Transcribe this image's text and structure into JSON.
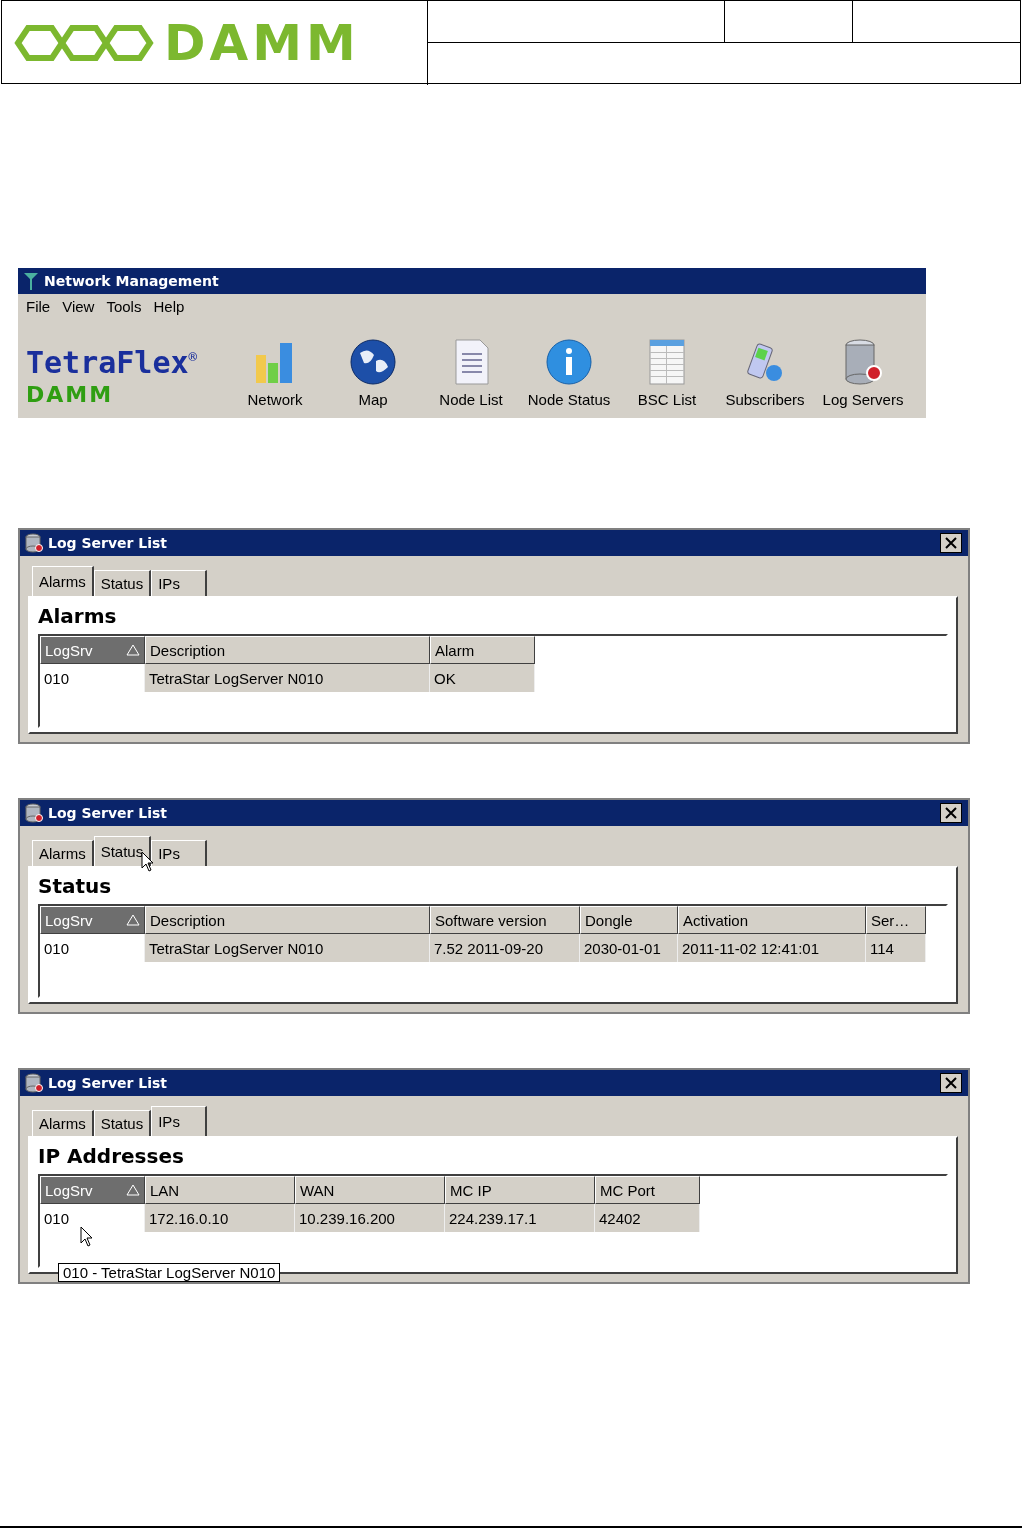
{
  "header": {
    "logo_text": "DAMM"
  },
  "network_management": {
    "title": "Network Management",
    "menu": [
      "File",
      "View",
      "Tools",
      "Help"
    ],
    "logo": {
      "name": "TetraFlex",
      "mark": "®",
      "brand": "DAMM"
    },
    "toolbar": [
      {
        "label": "Network",
        "kind": "chart"
      },
      {
        "label": "Map",
        "kind": "globe"
      },
      {
        "label": "Node List",
        "kind": "document"
      },
      {
        "label": "Node Status",
        "kind": "info"
      },
      {
        "label": "BSC List",
        "kind": "sheet"
      },
      {
        "label": "Subscribers",
        "kind": "phone"
      },
      {
        "label": "Log Servers",
        "kind": "database"
      }
    ]
  },
  "log_windows": [
    {
      "title": "Log Server List",
      "tabs": [
        {
          "label": "Alarms",
          "selected": true,
          "hovered": false
        },
        {
          "label": "Status",
          "selected": false,
          "hovered": false
        },
        {
          "label": "IPs",
          "selected": false,
          "hovered": false
        }
      ],
      "heading": "Alarms",
      "row_hovered": false,
      "columns": [
        {
          "label": "LogSrv",
          "sorted": true
        },
        {
          "label": "Description",
          "sorted": false
        },
        {
          "label": "Alarm",
          "sorted": false
        }
      ],
      "rows": [
        [
          "010",
          "TetraStar LogServer N010",
          "OK"
        ]
      ]
    },
    {
      "title": "Log Server List",
      "tabs": [
        {
          "label": "Alarms",
          "selected": false,
          "hovered": false
        },
        {
          "label": "Status",
          "selected": true,
          "hovered": true
        },
        {
          "label": "IPs",
          "selected": false,
          "hovered": false
        }
      ],
      "heading": "Status",
      "row_hovered": false,
      "columns": [
        {
          "label": "LogSrv",
          "sorted": true
        },
        {
          "label": "Description",
          "sorted": false
        },
        {
          "label": "Software version",
          "sorted": false
        },
        {
          "label": "Dongle",
          "sorted": false
        },
        {
          "label": "Activation",
          "sorted": false
        },
        {
          "label": "Ser…",
          "sorted": false
        }
      ],
      "rows": [
        [
          "010",
          "TetraStar LogServer N010",
          "7.52 2011-09-20",
          "2030-01-01",
          "2011-11-02 12:41:01",
          "114"
        ]
      ]
    },
    {
      "title": "Log Server List",
      "tabs": [
        {
          "label": "Alarms",
          "selected": false,
          "hovered": false
        },
        {
          "label": "Status",
          "selected": false,
          "hovered": false
        },
        {
          "label": "IPs",
          "selected": true,
          "hovered": false
        }
      ],
      "heading": "IP Addresses",
      "row_hovered": true,
      "columns": [
        {
          "label": "LogSrv",
          "sorted": true
        },
        {
          "label": "LAN",
          "sorted": false
        },
        {
          "label": "WAN",
          "sorted": false
        },
        {
          "label": "MC IP",
          "sorted": false
        },
        {
          "label": "MC Port",
          "sorted": false
        }
      ],
      "rows": [
        [
          "010",
          "172.16.0.10",
          "10.239.16.200",
          "224.239.17.1",
          "42402"
        ]
      ],
      "tooltip": "010 - TetraStar LogServer N010"
    }
  ]
}
